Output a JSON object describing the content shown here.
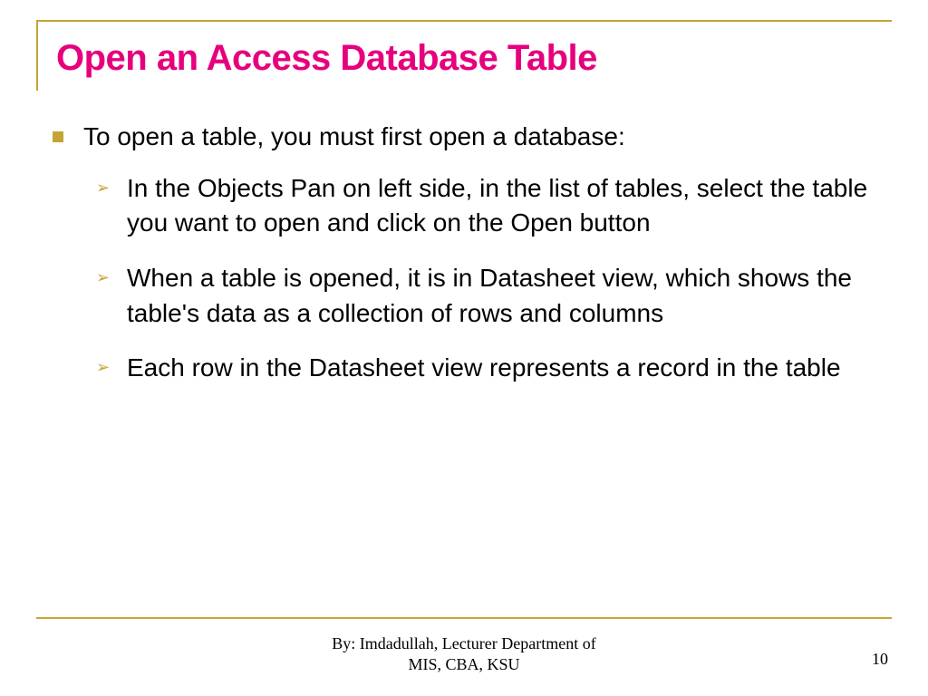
{
  "title": "Open an Access Database Table",
  "bullets": {
    "level1": "To open a table, you must first open a database:",
    "sub": [
      "In the Objects Pan on left side, in the list of tables, select the table you want to open and click on the Open button",
      "When a table is opened, it is in Datasheet view, which shows the table's data as a collection of rows and columns",
      "Each row in the Datasheet view represents a record in the table"
    ]
  },
  "footer": {
    "line1": "By: Imdadullah, Lecturer Department of",
    "line2": "MIS, CBA, KSU"
  },
  "page_number": "10"
}
